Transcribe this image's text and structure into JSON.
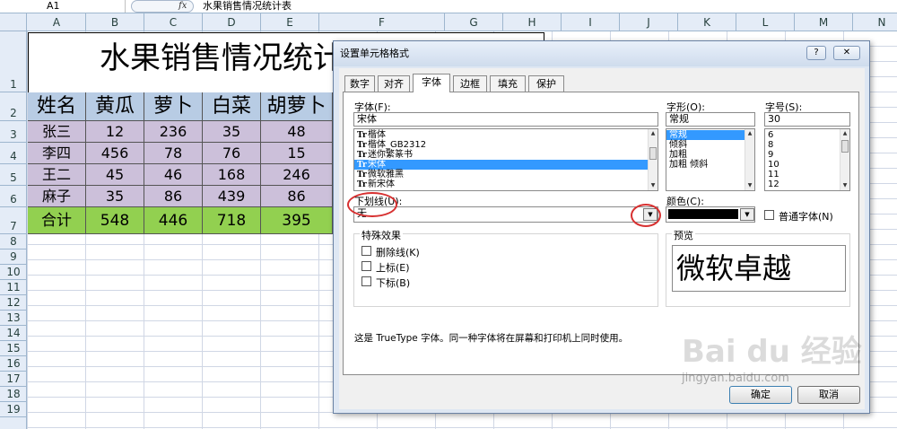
{
  "formula_bar": {
    "name_box": "A1",
    "fx": "fx",
    "content": "水果销售情况统计表"
  },
  "columns": [
    "A",
    "B",
    "C",
    "D",
    "E",
    "F",
    "G",
    "H",
    "I",
    "J",
    "K",
    "L",
    "M",
    "N"
  ],
  "rows": [
    "1",
    "2",
    "3",
    "4",
    "5",
    "6",
    "7",
    "8",
    "9",
    "10",
    "11",
    "12",
    "13",
    "14",
    "15",
    "16",
    "17",
    "18",
    "19"
  ],
  "sheet": {
    "title": "水果销售情况统计表",
    "header": [
      "姓名",
      "黄瓜",
      "萝卜",
      "白菜",
      "胡萝卜"
    ],
    "data_rows": [
      [
        "张三",
        "12",
        "236",
        "35",
        "48"
      ],
      [
        "李四",
        "456",
        "78",
        "76",
        "15"
      ],
      [
        "王二",
        "45",
        "46",
        "168",
        "246"
      ],
      [
        "麻子",
        "35",
        "86",
        "439",
        "86"
      ]
    ],
    "total_row": [
      "合计",
      "548",
      "446",
      "718",
      "395"
    ],
    "colors": {
      "header_bg": "#b8cce4",
      "data_bg": "#ccc0da",
      "total_bg": "#92d050"
    }
  },
  "dialog": {
    "title": "设置单元格格式",
    "help": "?",
    "close": "✕",
    "tabs": [
      "数字",
      "对齐",
      "字体",
      "边框",
      "填充",
      "保护"
    ],
    "active_tab": "字体",
    "font_label": "字体(F):",
    "font_value": "宋体",
    "font_list": [
      "楷体",
      "楷体_GB2312",
      "迷你繁篆书",
      "宋体",
      "微软雅黑",
      "新宋体"
    ],
    "font_selected": "宋体",
    "style_label": "字形(O):",
    "style_value": "常规",
    "style_list": [
      "常规",
      "倾斜",
      "加粗",
      "加粗 倾斜"
    ],
    "style_selected": "常规",
    "size_label": "字号(S):",
    "size_value": "30",
    "size_list": [
      "6",
      "8",
      "9",
      "10",
      "11",
      "12"
    ],
    "underline_label": "下划线(U):",
    "underline_value": "无",
    "color_label": "颜色(C):",
    "normal_font_label": "普通字体(N)",
    "effects_label": "特殊效果",
    "effects": [
      "删除线(K)",
      "上标(E)",
      "下标(B)"
    ],
    "preview_label": "预览",
    "preview_text": "微软卓越",
    "info_text": "这是 TrueType 字体。同一种字体将在屏幕和打印机上同时使用。",
    "ok_label": "确定",
    "cancel_label": "取消"
  },
  "watermark": {
    "brand": "Bai du 经验",
    "url": "jingyan.baidu.com"
  }
}
